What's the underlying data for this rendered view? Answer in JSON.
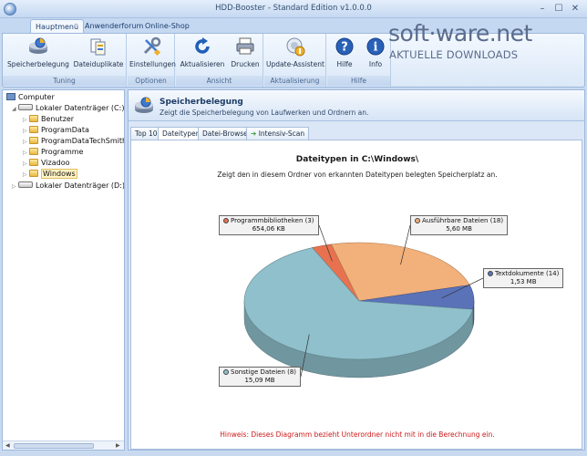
{
  "window": {
    "title": "HDD-Booster - Standard Edition v1.0.0.0",
    "min": "–",
    "max": "☐",
    "close": "✕"
  },
  "ribbon_tabs": [
    {
      "label": "Hauptmenü"
    },
    {
      "label": "Anwenderforum"
    },
    {
      "label": "Online-Shop"
    }
  ],
  "ribbon": {
    "groups": [
      {
        "label": "Tuning",
        "buttons": [
          {
            "label": "Speicherbelegung",
            "icon": "disk-usage-icon"
          },
          {
            "label": "Dateiduplikate",
            "icon": "duplicates-icon"
          }
        ]
      },
      {
        "label": "Optionen",
        "buttons": [
          {
            "label": "Einstellungen",
            "icon": "settings-icon"
          }
        ]
      },
      {
        "label": "Ansicht",
        "buttons": [
          {
            "label": "Aktualisieren",
            "icon": "refresh-icon"
          },
          {
            "label": "Drucken",
            "icon": "print-icon"
          }
        ]
      },
      {
        "label": "Aktualisierung",
        "buttons": [
          {
            "label": "Update-Assistent",
            "icon": "update-icon"
          }
        ]
      },
      {
        "label": "Hilfe",
        "buttons": [
          {
            "label": "Hilfe",
            "icon": "help-icon"
          },
          {
            "label": "Info",
            "icon": "info-icon"
          }
        ]
      }
    ]
  },
  "watermark": {
    "brand": "soft·ware.net",
    "tagline": "AKTUELLE DOWNLOADS"
  },
  "tree": {
    "root": "Computer",
    "drive1": "Lokaler Datenträger (C:)",
    "folders": [
      "Benutzer",
      "ProgramData",
      "ProgramDataTechSmith",
      "Programme",
      "Vizadoo",
      "Windows"
    ],
    "selected": "Windows",
    "drive2": "Lokaler Datenträger (D:)"
  },
  "pane": {
    "title": "Speicherbelegung",
    "subtitle": "Zeigt die Speicherbelegung von Laufwerken und Ordnern an."
  },
  "tabs": [
    {
      "label": "Top 10"
    },
    {
      "label": "Dateitypen",
      "active": true
    },
    {
      "label": "Datei-Browser"
    },
    {
      "label": "Intensiv-Scan"
    }
  ],
  "content": {
    "title": "Dateitypen in C:\\Windows\\",
    "subtitle": "Zeigt den in diesem Ordner von erkannten Dateitypen belegten Speicherplatz an.",
    "hint": "Hinweis: Dieses Diagramm bezieht Unterordner nicht mit in die Berechnung ein."
  },
  "chart_data": {
    "type": "pie",
    "slices": [
      {
        "label": "Programmbibliotheken (3)",
        "value_text": "654,06 KB",
        "value": 0.64,
        "color": "#e8724f"
      },
      {
        "label": "Ausführbare Dateien (18)",
        "value_text": "5,60 MB",
        "value": 5.6,
        "color": "#f2b07a"
      },
      {
        "label": "Textdokumente (14)",
        "value_text": "1,53 MB",
        "value": 1.53,
        "color": "#5a72b8"
      },
      {
        "label": "Sonstige Dateien (8)",
        "value_text": "15,09 MB",
        "value": 15.09,
        "color": "#8fc0cc"
      }
    ]
  }
}
